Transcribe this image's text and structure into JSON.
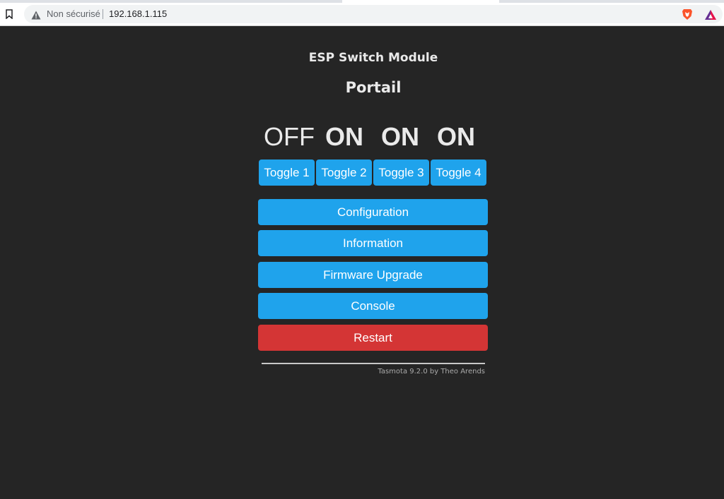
{
  "browser": {
    "security_label": "Non sécurisé",
    "url": "192.168.1.115",
    "icons": [
      "bookmark-icon",
      "warning-icon",
      "brave-shield-icon",
      "brave-rewards-icon"
    ]
  },
  "page": {
    "module_title": "ESP Switch Module",
    "device_name": "Portail",
    "relay_states": [
      "OFF",
      "ON",
      "ON",
      "ON"
    ],
    "toggles": [
      "Toggle 1",
      "Toggle 2",
      "Toggle 3",
      "Toggle 4"
    ],
    "menu": {
      "configuration": "Configuration",
      "information": "Information",
      "firmware_upgrade": "Firmware Upgrade",
      "console": "Console",
      "restart": "Restart"
    },
    "footer": "Tasmota 9.2.0 by Theo Arends"
  },
  "colors": {
    "background": "#252525",
    "button": "#1fa3ec",
    "button_danger": "#d43535",
    "text": "#eaeaea"
  }
}
